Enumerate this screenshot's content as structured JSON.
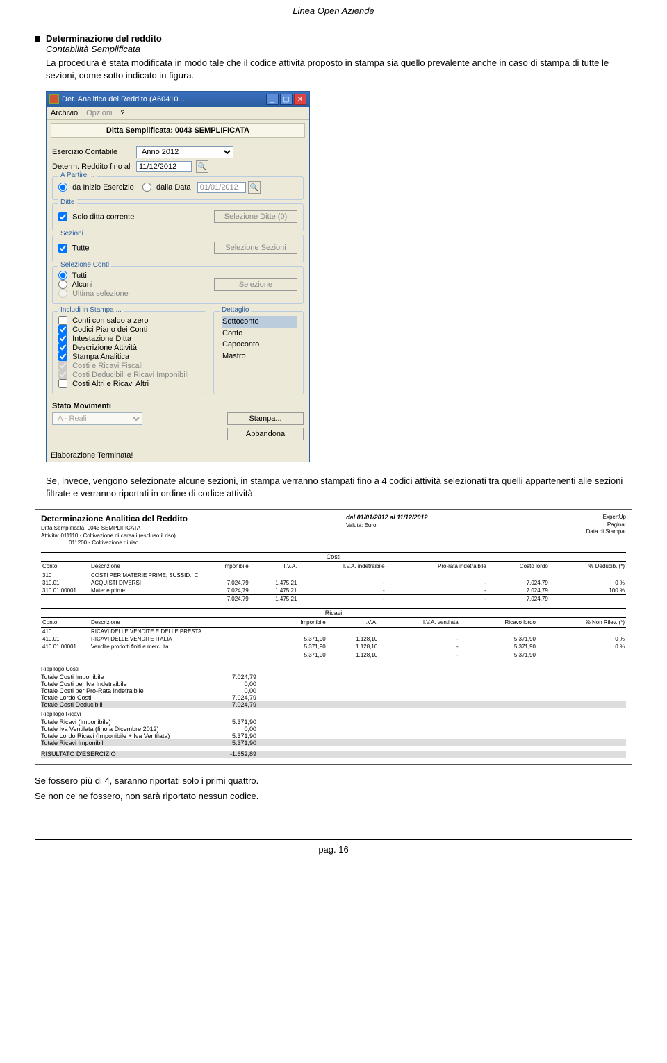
{
  "doc": {
    "header": "Linea Open Aziende",
    "section_title": "Determinazione del reddito",
    "section_subtitle": "Contabilità Semplificata",
    "intro": "La procedura è stata modificata in modo tale che il codice attività proposto in stampa sia quello prevalente anche in caso di stampa di tutte le sezioni, come sotto indicato in figura.",
    "mid_para": "Se, invece, vengono selezionate alcune sezioni, in stampa verranno stampati fino a 4 codici attività selezionati tra quelli appartenenti alle sezioni filtrate e verranno riportati in ordine di codice attività.",
    "after1": "Se fossero più di 4, saranno riportati solo i primi quattro.",
    "after2": "Se non ce ne fossero, non sarà riportato nessun codice.",
    "footer": "pag. 16"
  },
  "app": {
    "title": "Det. Analitica del Reddito (A60410....",
    "menu": {
      "archivio": "Archivio",
      "opzioni": "Opzioni",
      "help": "?"
    },
    "banner": "Ditta Semplificata: 0043 SEMPLIFICATA",
    "esercizio_label": "Esercizio Contabile",
    "esercizio_value": "Anno 2012",
    "determ_label": "Determ. Reddito fino al",
    "determ_value": "11/12/2012",
    "apartire": {
      "title": "A Partire ...",
      "opt1": "da Inizio Esercizio",
      "opt2": "dalla Data",
      "date_disabled": "01/01/2012"
    },
    "ditte": {
      "title": "Ditte",
      "solo": "Solo ditta corrente",
      "btn": "Selezione Ditte (0)"
    },
    "sezioni": {
      "title": "Sezioni",
      "tutte": "Tutte",
      "btn": "Selezione Sezioni"
    },
    "sel_conti": {
      "title": "Selezione Conti",
      "tutti": "Tutti",
      "alcuni": "Alcuni",
      "ultima": "Ultima selezione",
      "btn": "Selezione"
    },
    "includi": {
      "title": "Includi in Stampa ...",
      "items": [
        "Conti con saldo a zero",
        "Codici Piano dei Conti",
        "Intestazione Ditta",
        "Descrizione Attività",
        "Stampa Analitica",
        "Costi e Ricavi Fiscali",
        "Costi Deducibili e Ricavi Imponibili",
        "Costi Altri e Ricavi Altri"
      ]
    },
    "dettaglio": {
      "title": "Dettaglio",
      "items": [
        "Sottoconto",
        "Conto",
        "Capoconto",
        "Mastro"
      ]
    },
    "stato_label": "Stato Movimenti",
    "stato_value": "A - Reali",
    "btn_stampa": "Stampa...",
    "btn_abbandona": "Abbandona",
    "status": "Elaborazione Terminata!"
  },
  "report": {
    "title": "Determinazione Analitica del Reddito",
    "period": "dal 01/01/2012 al 11/12/2012",
    "sub1": "Ditta Semplificata: 0043 SEMPLIFICATA",
    "sub2a": "Attività:  011110 - Coltivazione di cereali (escluso il riso)",
    "sub2b": "011200 - Coltivazione di riso",
    "valuta": "Valuta: Euro",
    "meta": {
      "l1": "ExpertUp",
      "l2": "Pagina:",
      "l3": "Data di Stampa:"
    },
    "costi_head": "Costi",
    "ricavi_head": "Ricavi",
    "cols_costi": [
      "Conto",
      "Descrizione",
      "Imponibile",
      "I.V.A.",
      "I.V.A. indetraibile",
      "Pro-rata indetraibile",
      "Costo lordo",
      "% Deducib. (*)"
    ],
    "cols_ricavi": [
      "Conto",
      "Descrizione",
      "Imponibile",
      "I.V.A.",
      "I.V.A. ventilata",
      "",
      "Ricavo lordo",
      "% Non Rilev. (*)"
    ],
    "costi_rows": [
      {
        "c": "310",
        "d": "COSTI PER MATERIE PRIME, SUSSID., C"
      },
      {
        "c": "310.01",
        "d": "ACQUISTI DIVERSI",
        "imp": "7.024,79",
        "iva": "1.475,21",
        "ind": "-",
        "pro": "-",
        "lordo": "7.024,79",
        "pct": "0 %"
      },
      {
        "c": "310.01.00001",
        "d": "Materie prime",
        "imp": "7.024,79",
        "iva": "1.475,21",
        "ind": "-",
        "pro": "-",
        "lordo": "7.024,79",
        "pct": "100 %"
      }
    ],
    "costi_tot": {
      "imp": "7.024,79",
      "iva": "1.475,21",
      "ind": "-",
      "pro": "-",
      "lordo": "7.024,79"
    },
    "ricavi_rows": [
      {
        "c": "410",
        "d": "RICAVI DELLE VENDITE E DELLE PRESTA"
      },
      {
        "c": "410.01",
        "d": "RICAVI DELLE VENDITE ITALIA",
        "imp": "5.371,90",
        "iva": "1.128,10",
        "ind": "-",
        "pro": "",
        "lordo": "5.371,90",
        "pct": "0 %"
      },
      {
        "c": "410.01.00001",
        "d": "Vendite prodotti finiti e merci Ita",
        "imp": "5.371,90",
        "iva": "1.128,10",
        "ind": "-",
        "pro": "",
        "lordo": "5.371,90",
        "pct": "0 %"
      }
    ],
    "ricavi_tot": {
      "imp": "5.371,90",
      "iva": "1.128,10",
      "ind": "-",
      "pro": "",
      "lordo": "5.371,90"
    },
    "riep_costi_title": "Riepilogo Costi",
    "riep_costi": [
      {
        "l": "Totale Costi Imponibile",
        "v": "7.024,79"
      },
      {
        "l": "Totale Costi per Iva Indetraibile",
        "v": "0,00"
      },
      {
        "l": "Totale Costi per Pro-Rata Indetraibile",
        "v": "0,00"
      },
      {
        "l": "Totale Lordo Costi",
        "v": "7.024,79"
      },
      {
        "l": "Totale Costi Deducibili",
        "v": "7.024,79"
      }
    ],
    "riep_ric_title": "Riepilogo Ricavi",
    "riep_ric": [
      {
        "l": "Totale Ricavi (Imponibile)",
        "v": "5.371,90"
      },
      {
        "l": "Totale Iva Ventilata (fino a Dicembre 2012)",
        "v": "0,00"
      },
      {
        "l": "Totale Lordo Ricavi (Imponibile + Iva Ventilata)",
        "v": "5.371,90"
      },
      {
        "l": "Totale Ricavi Imponibili",
        "v": "5.371,90"
      }
    ],
    "risultato": {
      "l": "RISULTATO D'ESERCIZIO",
      "v": "-1.652,89"
    }
  }
}
